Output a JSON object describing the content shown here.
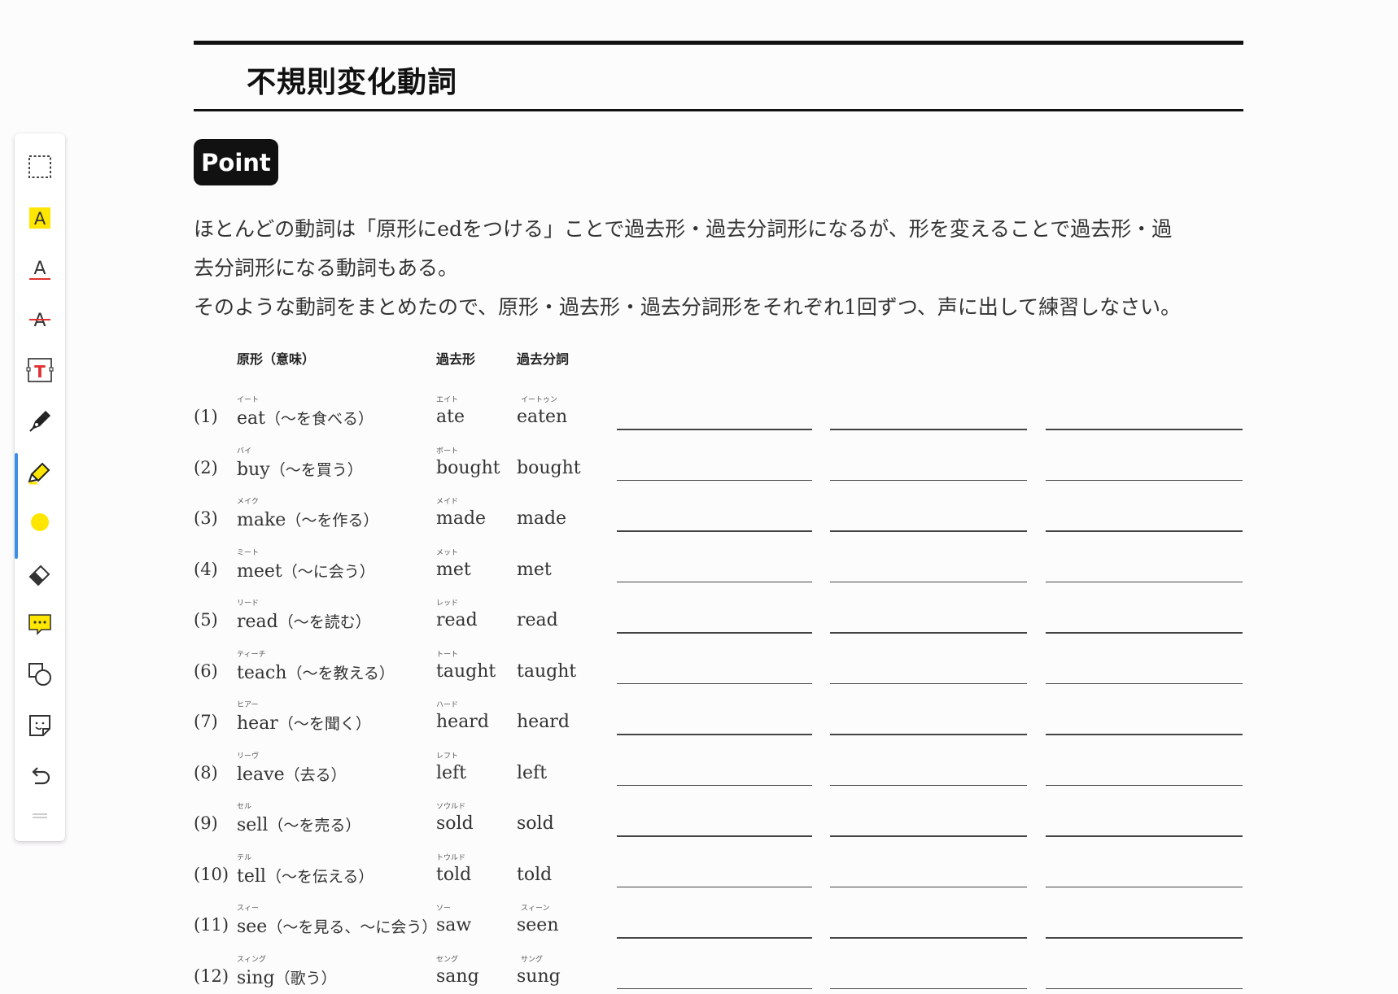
{
  "toolbar": {
    "tools": [
      {
        "name": "select-area-icon"
      },
      {
        "name": "highlight-text-icon",
        "glyph": "A"
      },
      {
        "name": "underline-text-icon",
        "glyph": "A"
      },
      {
        "name": "strikethrough-text-icon",
        "glyph": "A"
      },
      {
        "name": "text-box-icon",
        "glyph": "T"
      },
      {
        "name": "pen-icon"
      },
      {
        "name": "highlighter-icon"
      },
      {
        "name": "color-swatch-icon"
      },
      {
        "name": "eraser-icon"
      },
      {
        "name": "comment-icon"
      },
      {
        "name": "shapes-icon"
      },
      {
        "name": "sticker-icon"
      },
      {
        "name": "undo-icon"
      },
      {
        "name": "drag-handle-icon"
      }
    ],
    "selected_tool": "highlighter-icon",
    "accent_color": "#3d8fe6",
    "highlight_color": "#ffe600"
  },
  "document": {
    "title": "不規則変化動詞",
    "badge": "Point",
    "intro": [
      "ほとんどの動詞は「原形にedをつける」ことで過去形・過去分詞形になるが、形を変えることで過去形・過",
      "去分詞形になる動詞もある。",
      "そのような動詞をまとめたので、原形・過去形・過去分詞形をそれぞれ1回ずつ、声に出して練習しなさい。"
    ],
    "headers": {
      "base": "原形（意味）",
      "past": "過去形",
      "participle": "過去分詞"
    },
    "verbs": [
      {
        "num": "(1)",
        "base": "eat",
        "meaning": "（～を食べる）",
        "base_ruby": "イート",
        "past": "ate",
        "past_ruby": "エイト",
        "pp": "eaten",
        "pp_ruby": "イートゥン"
      },
      {
        "num": "(2)",
        "base": "buy",
        "meaning": "（～を買う）",
        "base_ruby": "バイ",
        "past": "bought",
        "past_ruby": "ボート",
        "pp": "bought",
        "pp_ruby": ""
      },
      {
        "num": "(3)",
        "base": "make",
        "meaning": "（～を作る）",
        "base_ruby": "メイク",
        "past": "made",
        "past_ruby": "メイド",
        "pp": "made",
        "pp_ruby": ""
      },
      {
        "num": "(4)",
        "base": "meet",
        "meaning": "（～に会う）",
        "base_ruby": "ミート",
        "past": "met",
        "past_ruby": "メット",
        "pp": "met",
        "pp_ruby": ""
      },
      {
        "num": "(5)",
        "base": "read",
        "meaning": "（～を読む）",
        "base_ruby": "リード",
        "past": "read",
        "past_ruby": "レッド",
        "pp": "read",
        "pp_ruby": ""
      },
      {
        "num": "(6)",
        "base": "teach",
        "meaning": "（～を教える）",
        "base_ruby": "ティーチ",
        "past": "taught",
        "past_ruby": "トート",
        "pp": "taught",
        "pp_ruby": ""
      },
      {
        "num": "(7)",
        "base": "hear",
        "meaning": "（～を聞く）",
        "base_ruby": "ヒアー",
        "past": "heard",
        "past_ruby": "ハード",
        "pp": "heard",
        "pp_ruby": ""
      },
      {
        "num": "(8)",
        "base": "leave",
        "meaning": "（去る）",
        "base_ruby": "リーヴ",
        "past": "left",
        "past_ruby": "レフト",
        "pp": "left",
        "pp_ruby": ""
      },
      {
        "num": "(9)",
        "base": "sell",
        "meaning": "（～を売る）",
        "base_ruby": "セル",
        "past": "sold",
        "past_ruby": "ソウルド",
        "pp": "sold",
        "pp_ruby": ""
      },
      {
        "num": "(10)",
        "base": "tell",
        "meaning": "（～を伝える）",
        "base_ruby": "テル",
        "past": "told",
        "past_ruby": "トウルド",
        "pp": "told",
        "pp_ruby": ""
      },
      {
        "num": "(11)",
        "base": "see",
        "meaning": "（～を見る、～に会う）",
        "base_ruby": "スィー",
        "past": "saw",
        "past_ruby": "ソー",
        "pp": "seen",
        "pp_ruby": "スィーン"
      },
      {
        "num": "(12)",
        "base": "sing",
        "meaning": "（歌う）",
        "base_ruby": "スィング",
        "past": "sang",
        "past_ruby": "セング",
        "pp": "sung",
        "pp_ruby": "サング"
      }
    ]
  }
}
